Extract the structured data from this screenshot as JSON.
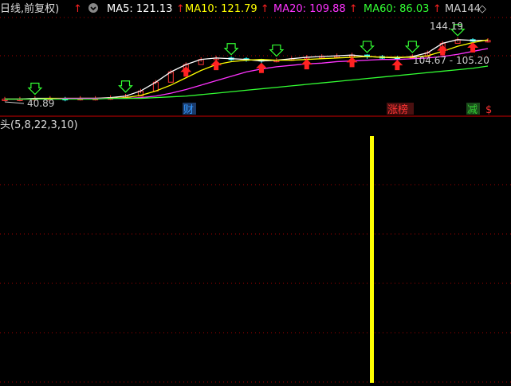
{
  "header": {
    "period_label": "日线,前复权)",
    "ma_items": [
      {
        "label": "MA5: 121.13",
        "color": "#ffffff"
      },
      {
        "label": "MA10: 121.79",
        "color": "#ffff00"
      },
      {
        "label": "MA20: 109.88",
        "color": "#ff33ff"
      },
      {
        "label": "MA60: 86.03",
        "color": "#33ff33"
      },
      {
        "label": "MA144",
        "color": "#cccccc"
      }
    ],
    "up_arrow_glyph": "↑",
    "diamond_glyph": "◇",
    "up_color": "#ff2222",
    "gear_icon": "settings-icon"
  },
  "price_panel": {
    "price_high_label": "144.19",
    "price_low_label": "40.89",
    "range_label": "104.67 - 105.20",
    "tags": [
      {
        "text": "财",
        "color": "#3399ff"
      },
      {
        "text": "涨榜",
        "color": "#ff3333"
      },
      {
        "text": "减",
        "color": "#33cc33"
      },
      {
        "text": "$",
        "color": "#ff3333"
      }
    ]
  },
  "indicator_panel": {
    "label": "头(5,8,22,3,10)"
  },
  "chart_data": {
    "type": "line",
    "title": "",
    "series": [
      {
        "name": "MA5",
        "values": [
          41,
          41,
          42,
          42,
          41,
          42,
          42,
          43,
          45,
          52,
          64,
          78,
          88,
          95,
          97,
          96,
          95,
          93,
          94,
          96,
          98,
          99,
          100,
          101,
          99,
          98,
          97,
          99,
          104,
          117,
          122,
          121,
          121
        ]
      },
      {
        "name": "MA10",
        "values": [
          41,
          41,
          41,
          42,
          42,
          42,
          42,
          42,
          43,
          46,
          52,
          60,
          70,
          80,
          88,
          92,
          94,
          95,
          94,
          94,
          95,
          96,
          97,
          98,
          99,
          98,
          98,
          98,
          100,
          106,
          113,
          118,
          121.79
        ]
      },
      {
        "name": "MA20",
        "values": [
          41,
          41,
          41,
          41,
          42,
          42,
          42,
          42,
          42,
          43,
          45,
          49,
          54,
          60,
          66,
          72,
          78,
          82,
          85,
          87,
          89,
          90,
          92,
          93,
          94,
          95,
          95,
          96,
          97,
          99,
          102,
          106,
          109.88
        ]
      },
      {
        "name": "MA60",
        "values": [
          41,
          41,
          41,
          41,
          41,
          41,
          41,
          42,
          42,
          42,
          43,
          44,
          45,
          47,
          49,
          51,
          53,
          55,
          57,
          59,
          61,
          63,
          65,
          67,
          69,
          71,
          73,
          75,
          77,
          79,
          81,
          83,
          86.03
        ]
      }
    ],
    "candles": [
      41,
      41,
      42,
      42,
      41,
      42,
      42,
      43,
      45,
      52,
      64,
      78,
      88,
      95,
      97,
      96,
      95,
      93,
      94,
      96,
      98,
      99,
      100,
      101,
      99,
      98,
      97,
      99,
      104,
      117,
      122,
      121,
      121
    ],
    "indicator_bars": [
      {
        "index": 21,
        "value": 1
      }
    ],
    "ylim": [
      35,
      150
    ]
  }
}
